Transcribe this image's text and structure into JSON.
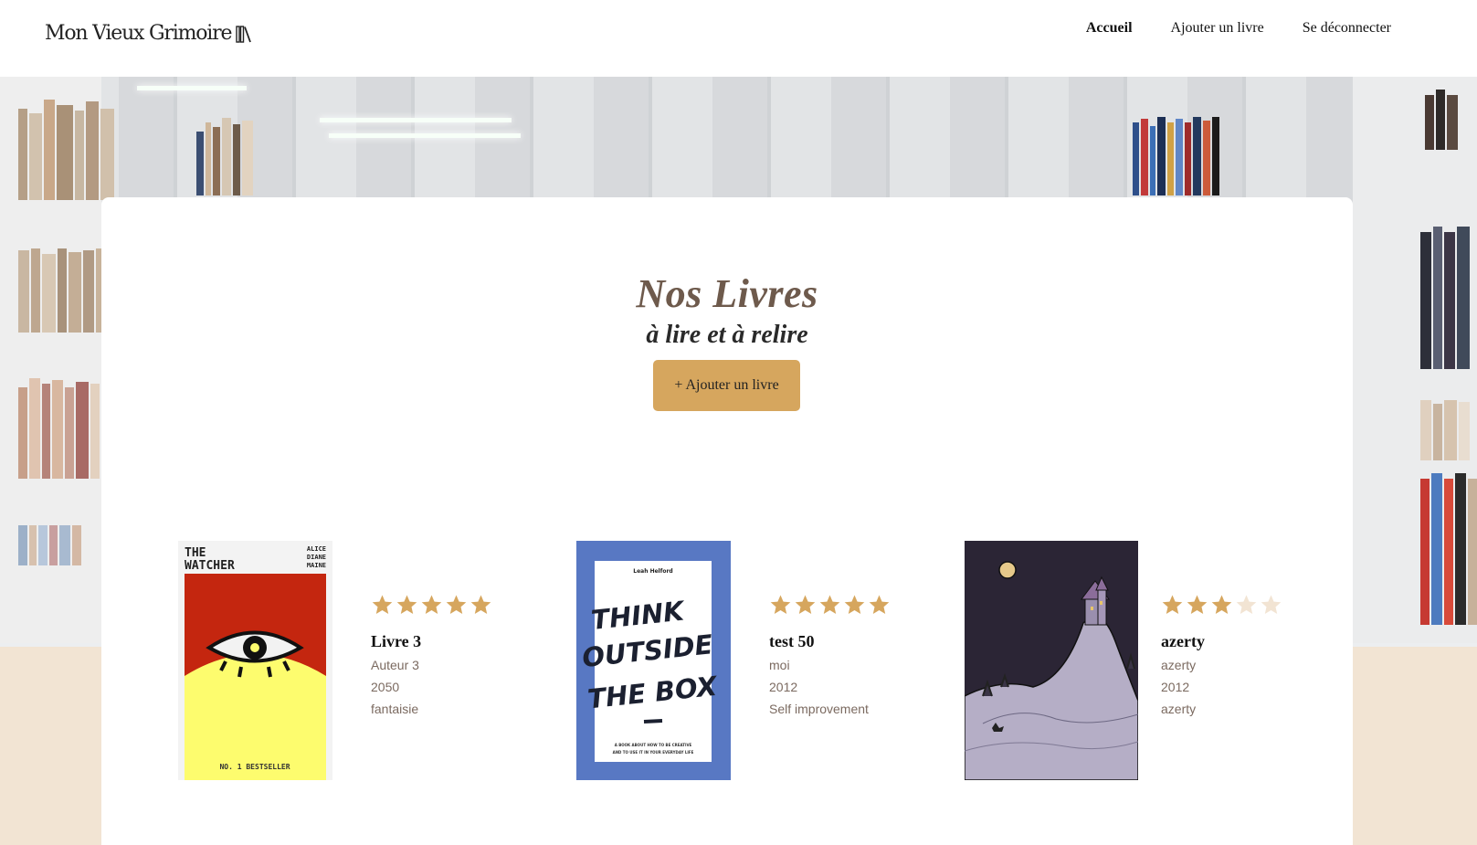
{
  "header": {
    "logo_text": "Mon Vieux Grimoire",
    "nav": [
      {
        "label": "Accueil",
        "active": true
      },
      {
        "label": "Ajouter un livre",
        "active": false
      },
      {
        "label": "Se déconnecter",
        "active": false
      }
    ]
  },
  "main": {
    "title": "Nos Livres",
    "subtitle": "à lire et à relire",
    "add_button": "+ Ajouter un livre"
  },
  "books": [
    {
      "title": "Livre 3",
      "author": "Auteur 3",
      "year": "2050",
      "genre": "fantaisie",
      "rating": 5,
      "cover": {
        "type": "watcher",
        "top_title_line1": "THE",
        "top_title_line2": "WATCHER",
        "author_line1": "ALICE",
        "author_line2": "DIANE",
        "author_line3": "MAINE",
        "bottom_text": "NO. 1 BESTSELLER"
      }
    },
    {
      "title": "test 50",
      "author": "moi",
      "year": "2012",
      "genre": "Self improvement",
      "rating": 5,
      "cover": {
        "type": "think",
        "author_line": "Leah Helford",
        "line1": "THINK",
        "line2": "OUTSIDE",
        "line3": "THE BOX",
        "small_line1": "A BOOK ABOUT HOW TO BE CREATIVE",
        "small_line2": "AND TO USE IT IN YOUR EVERYDAY LIFE"
      }
    },
    {
      "title": "azerty",
      "author": "azerty",
      "year": "2012",
      "genre": "azerty",
      "rating": 3,
      "cover": {
        "type": "castle"
      }
    }
  ],
  "colors": {
    "star_filled": "#d6a65e",
    "star_empty": "#f2e4d3",
    "button": "#d6a65e",
    "title": "#6e5a4c",
    "footer_band": "#f2e4d3"
  }
}
